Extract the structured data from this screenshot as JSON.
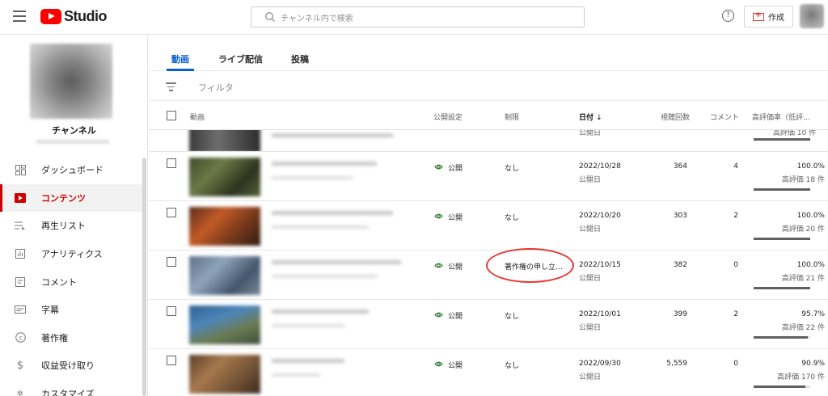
{
  "header": {
    "logo_text": "Studio",
    "search_placeholder": "チャンネル内で検索",
    "help_glyph": "?",
    "create_label": "作成"
  },
  "sidebar": {
    "channel_name": "チャンネル",
    "items": [
      {
        "label": "ダッシュボード",
        "icon": "dashboard-icon",
        "active": false
      },
      {
        "label": "コンテンツ",
        "icon": "content-icon",
        "active": true
      },
      {
        "label": "再生リスト",
        "icon": "playlist-icon",
        "active": false
      },
      {
        "label": "アナリティクス",
        "icon": "analytics-icon",
        "active": false
      },
      {
        "label": "コメント",
        "icon": "comment-icon",
        "active": false
      },
      {
        "label": "字幕",
        "icon": "subtitles-icon",
        "active": false
      },
      {
        "label": "著作権",
        "icon": "copyright-icon",
        "active": false
      },
      {
        "label": "収益受け取り",
        "icon": "earn-icon",
        "active": false
      },
      {
        "label": "カスタマイズ",
        "icon": "customize-icon",
        "active": false
      }
    ]
  },
  "tabs": [
    {
      "label": "動画",
      "active": true
    },
    {
      "label": "ライブ配信",
      "active": false
    },
    {
      "label": "投稿",
      "active": false
    }
  ],
  "filter_label": "フィルタ",
  "columns": {
    "video": "動画",
    "visibility": "公開設定",
    "restrictions": "制限",
    "date": "日付",
    "sort_arrow": "↓",
    "views": "視聴回数",
    "comments": "コメント",
    "likes": "高評価率（低評…"
  },
  "partial_row": {
    "date_sub": "公開日",
    "likes_sub": "高評価 10 件"
  },
  "rows": [
    {
      "visibility": "公開",
      "restriction": "なし",
      "date": "2022/10/28",
      "date_sub": "公開日",
      "views": "364",
      "comments": "4",
      "like_pct": "100.0%",
      "likes": "高評価 18 件",
      "like_ratio": 1.0
    },
    {
      "visibility": "公開",
      "restriction": "なし",
      "date": "2022/10/20",
      "date_sub": "公開日",
      "views": "303",
      "comments": "2",
      "like_pct": "100.0%",
      "likes": "高評価 20 件",
      "like_ratio": 1.0
    },
    {
      "visibility": "公開",
      "restriction": "著作権の申し立…",
      "date": "2022/10/15",
      "date_sub": "公開日",
      "views": "382",
      "comments": "0",
      "like_pct": "100.0%",
      "likes": "高評価 21 件",
      "like_ratio": 1.0
    },
    {
      "visibility": "公開",
      "restriction": "なし",
      "date": "2022/10/01",
      "date_sub": "公開日",
      "views": "399",
      "comments": "2",
      "like_pct": "95.7%",
      "likes": "高評価 22 件",
      "like_ratio": 0.957
    },
    {
      "visibility": "公開",
      "restriction": "なし",
      "date": "2022/09/30",
      "date_sub": "公開日",
      "views": "5,559",
      "comments": "0",
      "like_pct": "90.9%",
      "likes": "高評価 170 件",
      "like_ratio": 0.909
    }
  ],
  "colors": {
    "accent_red": "#cc0000",
    "link_blue": "#065fd4",
    "public_green": "#2e7d32",
    "annotation_red": "#e53935"
  }
}
